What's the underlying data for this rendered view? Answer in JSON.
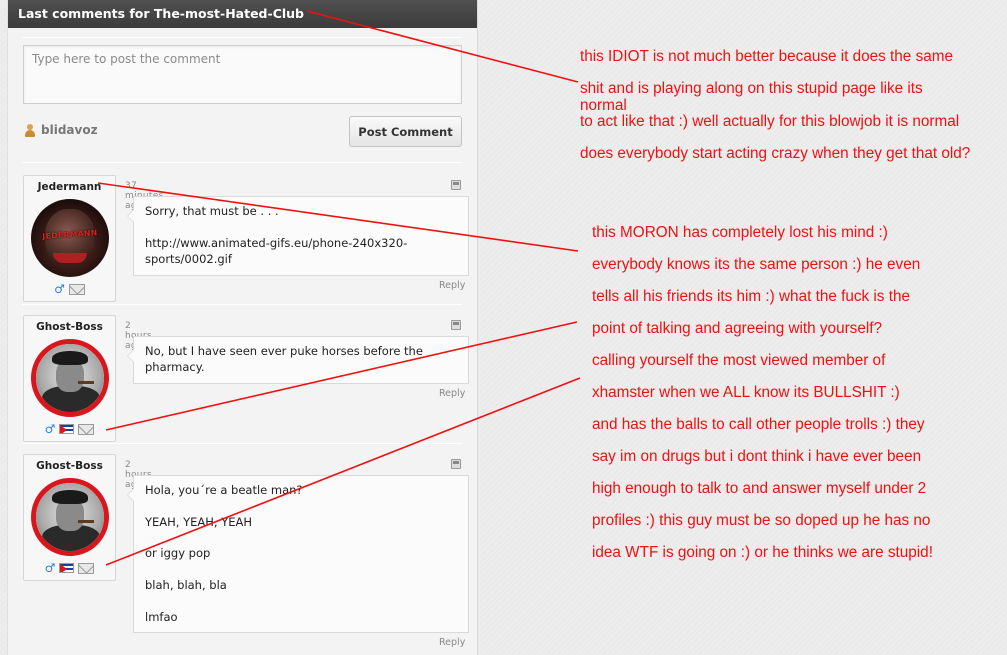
{
  "header": {
    "title": "Last comments for The-most-Hated-Club"
  },
  "composer": {
    "placeholder": "Type here to post the comment",
    "username": "blidavoz",
    "post_label": "Post Comment"
  },
  "comments": [
    {
      "author": "Jedermann",
      "avatar_text": "JEDERMANN",
      "time": "37 minutes ago",
      "text": "Sorry, that must be . . .\n\nhttp://www.animated-gifs.eu/phone-240x320-\nsports/0002.gif",
      "reply_label": "Reply"
    },
    {
      "author": "Ghost-Boss",
      "time": "2 hours ago",
      "text": "No, but I have seen ever puke horses before the\npharmacy.",
      "reply_label": "Reply"
    },
    {
      "author": "Ghost-Boss",
      "time": "2 hours ago",
      "text": "Hola, you´re a beatle man?\n\nYEAH, YEAH, YEAH\n\nor iggy pop\n\nblah, blah, bla\n\nlmfao",
      "reply_label": "Reply"
    }
  ],
  "annotations": {
    "block1": [
      "this IDIOT is  not much better because it does the same",
      "shit and is playing along on this stupid page like its",
      "normal",
      "to act like that :) well actually for this blowjob it is normal",
      "does everybody start acting crazy when they get that old?"
    ],
    "block2": [
      "this MORON has completely lost his mind :)",
      "everybody knows its the same person :) he even",
      "tells all his friends its him :) what the fuck is the",
      "point of talking and agreeing with yourself?",
      "calling yourself the most viewed member of",
      "xhamster when we ALL know its BULLSHIT :)",
      "and has the balls to call other people trolls :)  they",
      "say im on drugs but i dont think i have ever been",
      "high enough to talk to and answer myself under 2",
      "profiles :) this guy must be so doped up he has no",
      "idea WTF is going on :) or he thinks we are stupid!"
    ],
    "color": "#ee1111"
  },
  "icons": {
    "user": "user-icon",
    "male": "male-gender-icon",
    "flag": "cuba-flag-icon",
    "mail": "mail-icon",
    "report": "report-flag-icon"
  }
}
